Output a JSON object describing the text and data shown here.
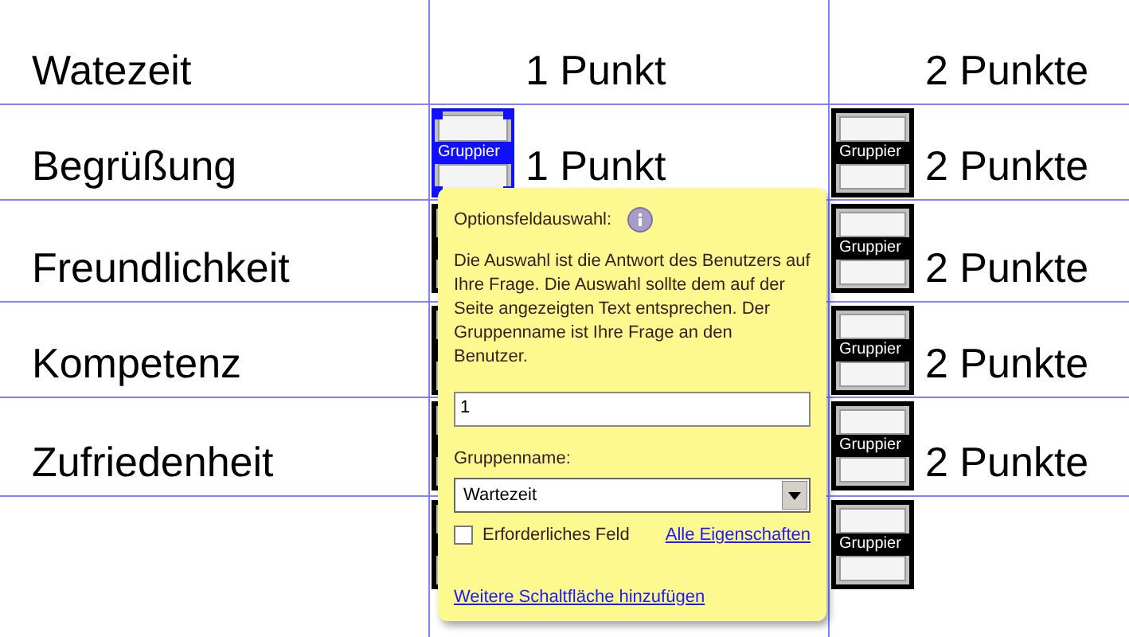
{
  "rows": [
    {
      "label": "Watezeit",
      "cells": [
        {
          "text": "1 Punkt"
        },
        {
          "text": "2 Punkte"
        }
      ]
    },
    {
      "label": "Begrüßung",
      "cells": [
        {
          "text": "1 Punkt",
          "widget": {
            "label": "Gruppier",
            "selected": true
          }
        },
        {
          "text": "2 Punkte",
          "widget": {
            "label": "Gruppier",
            "selected": false
          }
        }
      ]
    },
    {
      "label": "Freundlichkeit",
      "cells": [
        {
          "widget": {
            "selected": false
          }
        },
        {
          "text": "2 Punkte",
          "widget": {
            "label": "Gruppier",
            "selected": false
          }
        }
      ]
    },
    {
      "label": "Kompetenz",
      "cells": [
        {
          "widget": {
            "selected": false
          }
        },
        {
          "text": "2 Punkte",
          "widget": {
            "label": "Gruppier",
            "selected": false
          }
        }
      ]
    },
    {
      "label": "Zufriedenheit",
      "cells": [
        {
          "widget": {
            "selected": false
          }
        },
        {
          "text": "2 Punkte",
          "widget": {
            "label": "Gruppier",
            "selected": false
          }
        }
      ]
    },
    {
      "cells": [
        {
          "widget": {
            "selected": false
          }
        },
        {
          "widget": {
            "label": "Gruppier",
            "selected": false
          }
        }
      ]
    }
  ],
  "popup": {
    "title": "Optionsfeldauswahl:",
    "description": "Die Auswahl ist die Antwort des Benutzers auf Ihre Frage. Die Auswahl sollte dem auf der Seite angezeigten Text entsprechen. Der Gruppenname ist Ihre Frage an den Benutzer.",
    "value": "1",
    "group_label": "Gruppenname:",
    "group_value": "Wartezeit",
    "required": {
      "label": "Erforderliches Feld",
      "checked": false
    },
    "all_properties_link": "Alle Eigenschaften",
    "add_button_link": "Weitere Schaltfläche hinzufügen"
  }
}
